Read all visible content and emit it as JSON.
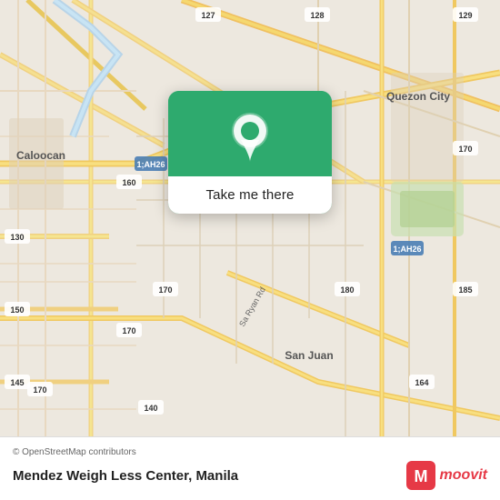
{
  "map": {
    "attribution": "© OpenStreetMap contributors",
    "background_color": "#e8e0d8"
  },
  "popup": {
    "button_label": "Take me there",
    "icon": "location-pin"
  },
  "bottom_bar": {
    "place_name": "Mendez Weigh Less Center, Manila",
    "attribution": "© OpenStreetMap contributors",
    "moovit_label": "moovit"
  }
}
